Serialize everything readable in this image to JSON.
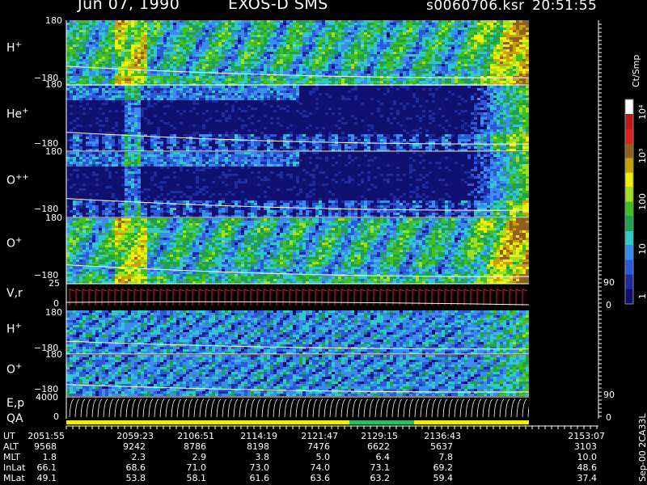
{
  "header": {
    "date": "Jun 07, 1990",
    "instrument": "EXOS-D SMS",
    "file": "s0060706.ksr",
    "time": "20:51:55"
  },
  "colorbar": {
    "unit": "Ct/Smp",
    "ticks": [
      "1",
      "10",
      "100",
      "10³",
      "10⁴"
    ],
    "colors": [
      "#101070",
      "#1c2ca0",
      "#2a5ad8",
      "#3a8cf0",
      "#30c8c8",
      "#20a050",
      "#40c020",
      "#a0e020",
      "#f0f000",
      "#c8a000",
      "#906020",
      "#e02020",
      "#c01818",
      "#ffffff"
    ]
  },
  "panels": [
    {
      "label": "H",
      "sup": "+",
      "ytop": "180",
      "ybot": "−180"
    },
    {
      "label": "He",
      "sup": "+",
      "ytop": "180",
      "ybot": "−180"
    },
    {
      "label": "O",
      "sup": "++",
      "ytop": "180",
      "ybot": "−180"
    },
    {
      "label": "O",
      "sup": "+",
      "ytop": "180",
      "ybot": "−180"
    },
    {
      "label": "V,r",
      "sup": "",
      "ytop": "25",
      "ybot": "0",
      "rtop": "90",
      "rbot": "0"
    },
    {
      "label": "H",
      "sup": "+",
      "ytop": "180",
      "ybot": "−180"
    },
    {
      "label": "O",
      "sup": "+",
      "ytop": "180",
      "ybot": "−180"
    },
    {
      "label": "E,p",
      "sup": "",
      "ytop": "4000",
      "ybot": "0",
      "rtop": "90",
      "rbot": "0"
    }
  ],
  "qa_label": "QA",
  "chart_data": {
    "type": "heatmap",
    "title": "Jun 07, 1990   EXOS-D SMS   s0060706.ksr  20:51:55",
    "ylim": [
      -180,
      180
    ],
    "zscale": "log",
    "zlim": [
      1,
      10000
    ],
    "zlabel": "Ct/Smp",
    "x_ticks": [
      "2051:55",
      "2059:23",
      "2106:51",
      "2114:19",
      "2121:47",
      "2129:15",
      "2136:43",
      "2153:07"
    ]
  },
  "ephemeris": {
    "rows": [
      {
        "label": "UT",
        "values": [
          "2051:55",
          "2059:23",
          "2106:51",
          "2114:19",
          "2121:47",
          "2129:15",
          "2136:43",
          "2153:07"
        ]
      },
      {
        "label": "ALT",
        "values": [
          "9568",
          "9242",
          "8786",
          "8198",
          "7476",
          "6622",
          "5637",
          "3103"
        ]
      },
      {
        "label": "MLT",
        "values": [
          "1.8",
          "2.3",
          "2.9",
          "3.8",
          "5.0",
          "6.4",
          "7.8",
          "10.0"
        ]
      },
      {
        "label": "InLat",
        "values": [
          "66.1",
          "68.6",
          "71.0",
          "73.0",
          "74.0",
          "73.1",
          "69.2",
          "48.6"
        ]
      },
      {
        "label": "MLat",
        "values": [
          "49.1",
          "53.8",
          "58.1",
          "61.6",
          "63.6",
          "63.2",
          "59.4",
          "37.4"
        ]
      }
    ],
    "footer": "Sep-00 2CA33L"
  }
}
